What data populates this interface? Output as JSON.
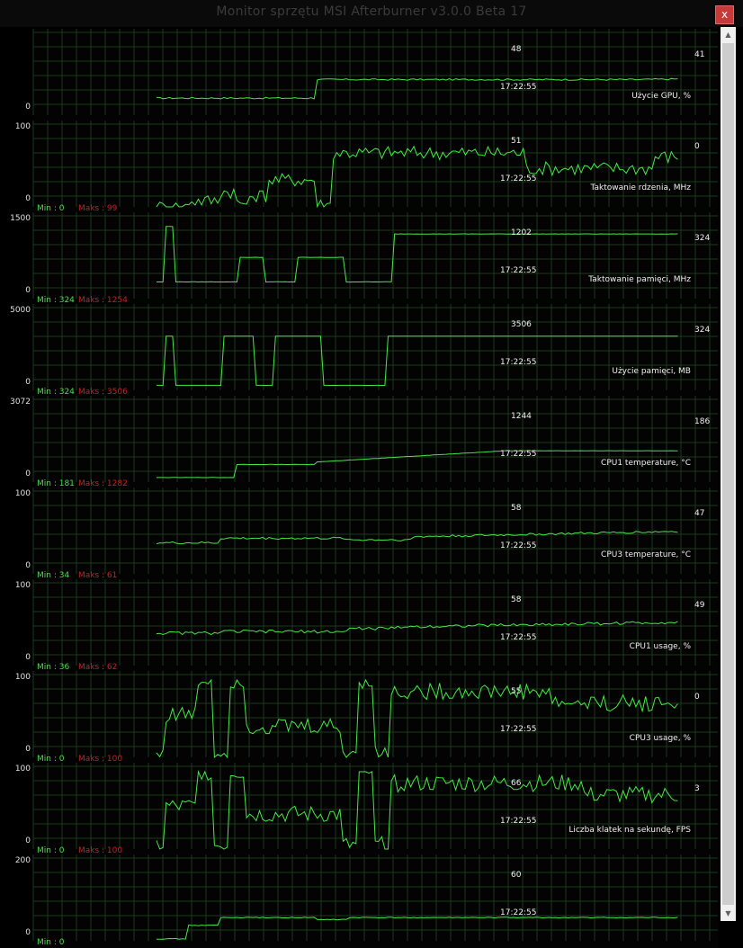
{
  "window": {
    "title": "Monitor sprzętu MSI Afterburner v3.0.0 Beta 17",
    "close_label": "x"
  },
  "time_label": "17:22:55",
  "panels": [
    {
      "title": "Użycie GPU, %",
      "min_label": "",
      "max_label": "",
      "axis_top": "",
      "axis_bottom": "0",
      "current": "48",
      "last": "41",
      "ylim": [
        0,
        100
      ],
      "series": []
    },
    {
      "title": "Taktowanie rdzenia, MHz",
      "min_label": "Min : 0",
      "max_label": "Maks : 99",
      "axis_top": "100",
      "axis_bottom": "0",
      "current": "51",
      "last": "0",
      "ylim": [
        0,
        100
      ],
      "series": []
    },
    {
      "title": "Taktowanie pamięci, MHz",
      "min_label": "Min : 324",
      "max_label": "Maks : 1254",
      "axis_top": "1500",
      "axis_bottom": "0",
      "current": "1202",
      "last": "324",
      "ylim": [
        0,
        1500
      ],
      "series": []
    },
    {
      "title": "Użycie pamięci, MB",
      "min_label": "Min : 324",
      "max_label": "Maks : 3506",
      "axis_top": "5000",
      "axis_bottom": "0",
      "current": "3506",
      "last": "324",
      "ylim": [
        0,
        5000
      ],
      "series": []
    },
    {
      "title": "CPU1 temperature, °C",
      "min_label": "Min : 181",
      "max_label": "Maks : 1282",
      "axis_top": "3072",
      "axis_bottom": "0",
      "current": "1244",
      "last": "186",
      "ylim": [
        0,
        3072
      ],
      "series": []
    },
    {
      "title": "CPU3 temperature, °C",
      "min_label": "Min : 34",
      "max_label": "Maks : 61",
      "axis_top": "100",
      "axis_bottom": "0",
      "current": "58",
      "last": "47",
      "ylim": [
        0,
        100
      ],
      "series": []
    },
    {
      "title": "CPU1 usage, %",
      "min_label": "Min : 36",
      "max_label": "Maks : 62",
      "axis_top": "100",
      "axis_bottom": "0",
      "current": "58",
      "last": "49",
      "ylim": [
        0,
        100
      ],
      "series": []
    },
    {
      "title": "CPU3 usage, %",
      "min_label": "Min : 0",
      "max_label": "Maks : 100",
      "axis_top": "100",
      "axis_bottom": "0",
      "current": "55",
      "last": "0",
      "ylim": [
        0,
        100
      ],
      "series": []
    },
    {
      "title": "Liczba klatek na sekundę, FPS",
      "min_label": "Min : 0",
      "max_label": "Maks : 100",
      "axis_top": "100",
      "axis_bottom": "0",
      "current": "66",
      "last": "3",
      "ylim": [
        0,
        100
      ],
      "series": []
    },
    {
      "title": "",
      "min_label": "Min : 0",
      "max_label": "",
      "axis_top": "200",
      "axis_bottom": "0",
      "current": "60",
      "last": "",
      "ylim": [
        0,
        200
      ],
      "series": []
    }
  ],
  "colors": {
    "line": "#46e846",
    "grid": "#1d3a1d",
    "min_text": "#4ae04a",
    "max_text": "#c42222",
    "close": "#c83a3a"
  },
  "chart_data": {
    "type": "line",
    "shared": {
      "x": [
        0,
        2,
        4,
        6,
        8,
        10,
        12,
        14,
        16,
        18,
        20,
        22,
        24,
        26,
        28,
        30,
        32,
        34,
        36,
        38,
        40,
        42,
        44,
        46,
        48,
        50,
        52,
        54,
        56,
        58,
        60,
        62,
        64,
        66,
        68,
        70,
        72,
        74,
        76,
        78,
        80,
        82,
        84,
        86,
        88,
        90,
        92,
        94,
        96,
        98,
        100
      ],
      "note": ""
    },
    "series": []
  }
}
